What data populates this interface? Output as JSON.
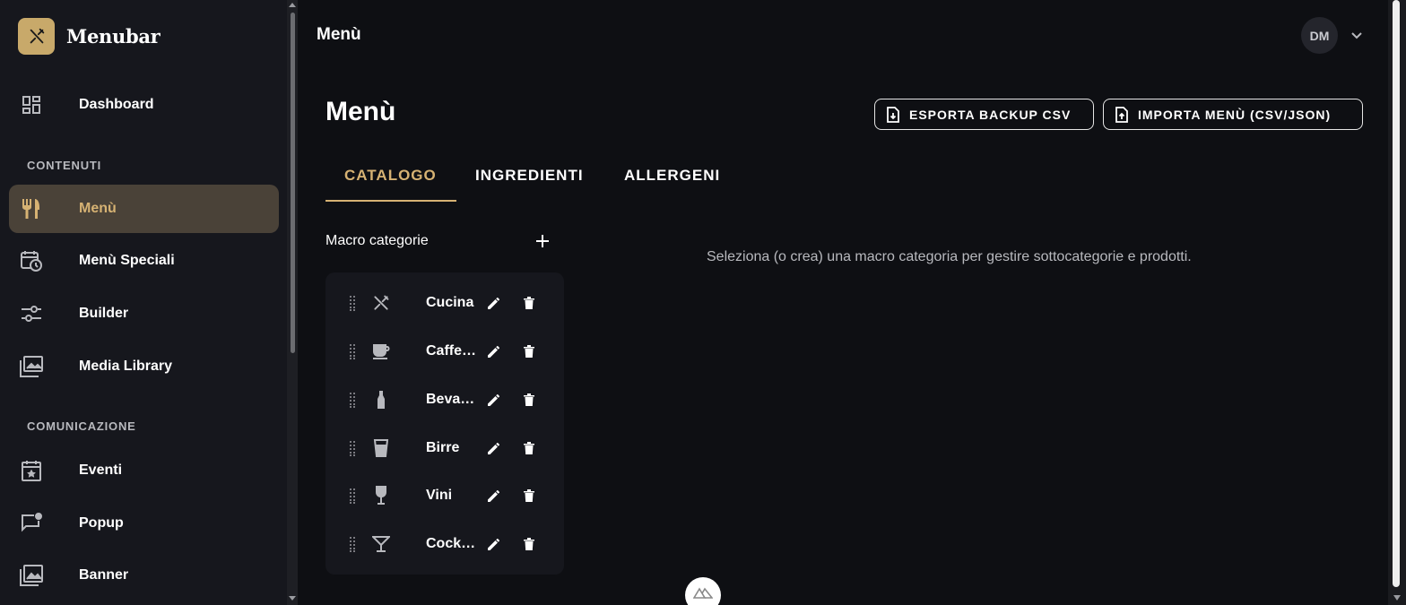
{
  "brand": {
    "name": "Menubar",
    "logo_icon": "fork-knife-icon",
    "logo_color": "#c8a96a"
  },
  "sidebar": {
    "dashboard": {
      "label": "Dashboard",
      "icon": "dashboard-icon"
    },
    "section_contents": "CONTENUTI",
    "items_contents": [
      {
        "label": "Menù",
        "icon": "restaurant-icon",
        "active": true
      },
      {
        "label": "Menù Speciali",
        "icon": "calendar-clock-icon"
      },
      {
        "label": "Builder",
        "icon": "sliders-icon"
      },
      {
        "label": "Media Library",
        "icon": "photo-library-icon"
      }
    ],
    "section_communication": "COMUNICAZIONE",
    "items_communication": [
      {
        "label": "Eventi",
        "icon": "event-star-icon"
      },
      {
        "label": "Popup",
        "icon": "chat-notification-icon"
      },
      {
        "label": "Banner",
        "icon": "image-banner-icon"
      }
    ]
  },
  "topbar": {
    "title": "Menù",
    "avatar_initials": "DM"
  },
  "main": {
    "title": "Menù",
    "export_button": "ESPORTA BACKUP CSV",
    "import_button": "IMPORTA MENÙ (CSV/JSON)",
    "tabs": [
      {
        "label": "CATALOGO",
        "active": true
      },
      {
        "label": "INGREDIENTI"
      },
      {
        "label": "ALLERGENI"
      }
    ],
    "macro_title": "Macro categorie",
    "categories": [
      {
        "name": "Cucina",
        "icon": "utensils-icon"
      },
      {
        "name": "Caffetteria",
        "icon": "coffee-cup-icon"
      },
      {
        "name": "Bevande",
        "icon": "bottle-icon"
      },
      {
        "name": "Birre",
        "icon": "beer-glass-icon"
      },
      {
        "name": "Vini",
        "icon": "wine-glass-icon"
      },
      {
        "name": "Cocktail",
        "icon": "cocktail-icon"
      }
    ],
    "empty_message": "Seleziona (o crea) una macro categoria per gestire sottocategorie e prodotti."
  },
  "colors": {
    "accent": "#d6b273",
    "active_bg": "#4a4238",
    "background": "#0e0f13",
    "sidebar_bg": "#16171d"
  }
}
